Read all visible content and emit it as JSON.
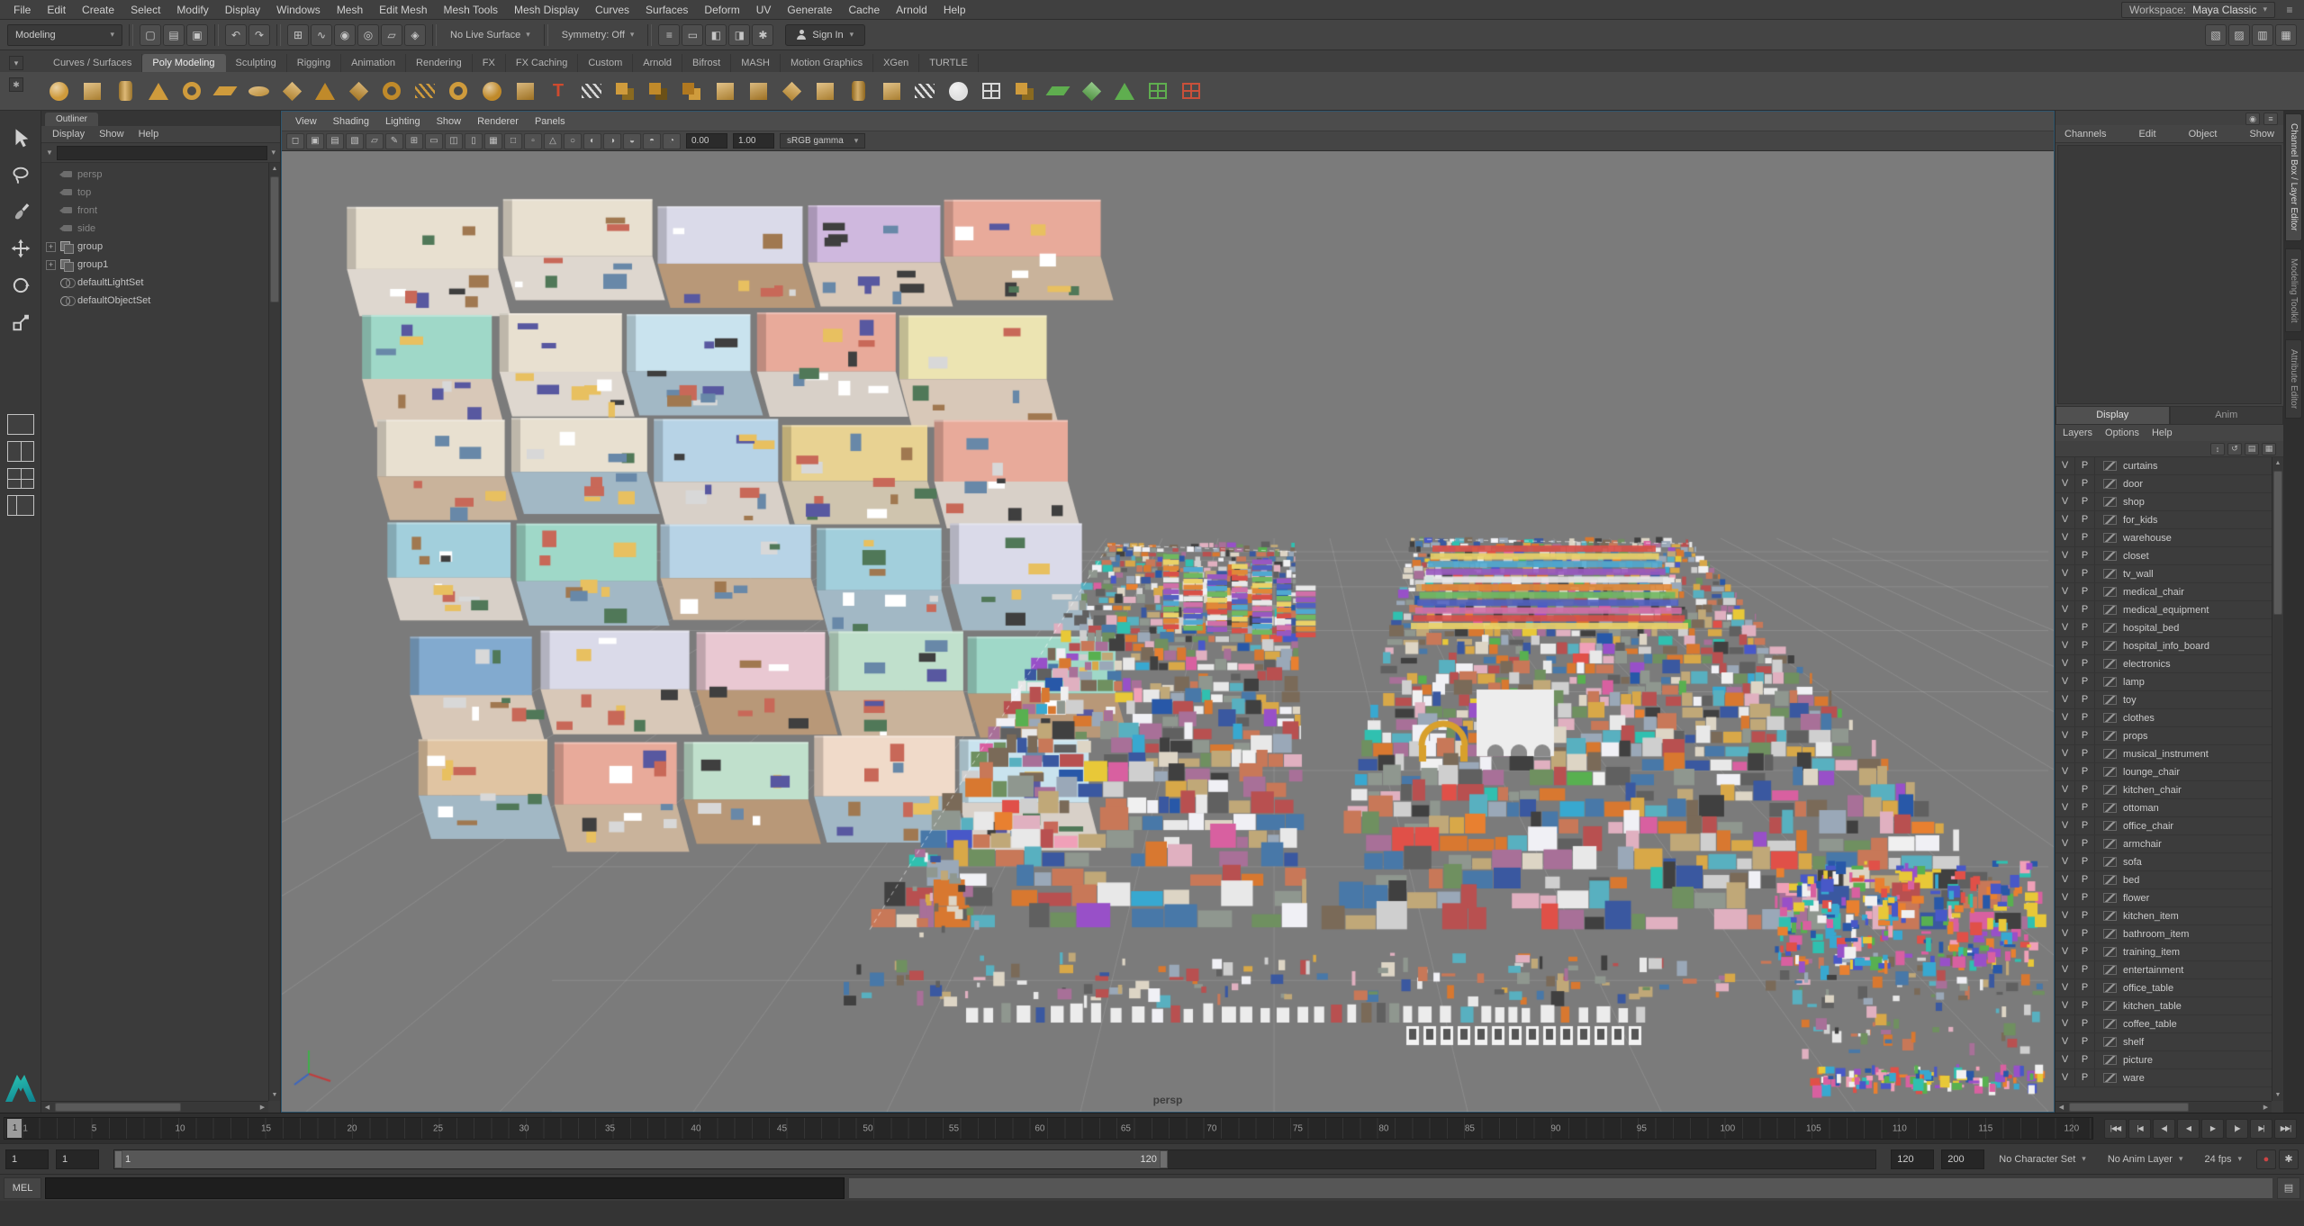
{
  "menubar": {
    "menus": [
      "File",
      "Edit",
      "Create",
      "Select",
      "Modify",
      "Display",
      "Windows",
      "Mesh",
      "Edit Mesh",
      "Mesh Tools",
      "Mesh Display",
      "Curves",
      "Surfaces",
      "Deform",
      "UV",
      "Generate",
      "Cache",
      "Arnold",
      "Help"
    ],
    "workspace_label": "Workspace:",
    "workspace_value": "Maya Classic"
  },
  "statusline": {
    "mode": "Modeling",
    "file_icons": [
      {
        "name": "new-scene-icon",
        "glyph": "▢"
      },
      {
        "name": "open-scene-icon",
        "glyph": "▤"
      },
      {
        "name": "save-scene-icon",
        "glyph": "▣"
      }
    ],
    "history_icons": [
      {
        "name": "undo-icon",
        "glyph": "↶"
      },
      {
        "name": "redo-icon",
        "glyph": "↷"
      }
    ],
    "snap_icons": [
      {
        "name": "snap-to-grid-icon",
        "glyph": "⊞"
      },
      {
        "name": "snap-to-curve-icon",
        "glyph": "∿"
      },
      {
        "name": "snap-to-point-icon",
        "glyph": "◉"
      },
      {
        "name": "snap-to-projected-center-icon",
        "glyph": "◎"
      },
      {
        "name": "snap-to-view-plane-icon",
        "glyph": "▱"
      },
      {
        "name": "make-live-icon",
        "glyph": "◈"
      }
    ],
    "no_live_surface": "No Live Surface",
    "symmetry": "Symmetry: Off",
    "render_icons": [
      {
        "name": "construction-history-icon",
        "glyph": "≡"
      },
      {
        "name": "open-render-view-icon",
        "glyph": "▭"
      },
      {
        "name": "render-current-frame-icon",
        "glyph": "◧"
      },
      {
        "name": "ipr-render-icon",
        "glyph": "◨"
      },
      {
        "name": "render-settings-icon",
        "glyph": "✱"
      }
    ],
    "sign_in": "Sign In",
    "right_icons": [
      {
        "name": "toggle-modeling-toolkit-icon",
        "glyph": "▧"
      },
      {
        "name": "toggle-tool-settings-icon",
        "glyph": "▨"
      },
      {
        "name": "toggle-attribute-editor-icon",
        "glyph": "▥"
      },
      {
        "name": "toggle-channel-box-icon",
        "glyph": "▦"
      }
    ]
  },
  "shelf": {
    "gutter_icons": [
      {
        "name": "shelf-tab-options-icon",
        "glyph": "▾"
      },
      {
        "name": "shelf-editor-icon",
        "glyph": "✱"
      }
    ],
    "tabs": [
      "Curves / Surfaces",
      "Poly Modeling",
      "Sculpting",
      "Rigging",
      "Animation",
      "Rendering",
      "FX",
      "FX Caching",
      "Custom",
      "Arnold",
      "Bifrost",
      "MASH",
      "Motion Graphics",
      "XGen",
      "TURTLE"
    ],
    "active_tab": "Poly Modeling",
    "icons": [
      {
        "name": "polygon-sphere-icon",
        "shape": "circle",
        "color": "#cf9b3c"
      },
      {
        "name": "polygon-cube-icon",
        "shape": "square",
        "color": "#cf9b3c"
      },
      {
        "name": "polygon-cylinder-icon",
        "shape": "rect",
        "color": "#cf9b3c"
      },
      {
        "name": "polygon-cone-icon",
        "shape": "tri",
        "color": "#cf9b3c"
      },
      {
        "name": "polygon-torus-icon",
        "shape": "ring",
        "color": "#cf9b3c"
      },
      {
        "name": "polygon-plane-icon",
        "shape": "flat",
        "color": "#cf9b3c"
      },
      {
        "name": "polygon-disc-icon",
        "shape": "ellipse",
        "color": "#cf9b3c"
      },
      {
        "name": "polygon-platonic-icon",
        "shape": "diamond",
        "color": "#cf9b3c"
      },
      {
        "name": "polygon-pyramid-icon",
        "shape": "tri",
        "color": "#c08a2a"
      },
      {
        "name": "polygon-prism-icon",
        "shape": "diamond",
        "color": "#c08a2a"
      },
      {
        "name": "polygon-pipe-icon",
        "shape": "ring",
        "color": "#c08a2a"
      },
      {
        "name": "polygon-helix-icon",
        "shape": "lines",
        "color": "#cf9b3c"
      },
      {
        "name": "polygon-gear-icon",
        "shape": "ring",
        "color": "#cf9b3c"
      },
      {
        "name": "polygon-soccer-ball-icon",
        "shape": "circle",
        "color": "#c08a2a"
      },
      {
        "name": "polygon-superellipse-icon",
        "shape": "square",
        "color": "#c08a2a"
      },
      {
        "name": "polygon-type-icon",
        "shape": "letter",
        "glyph": "T",
        "color": "#cf4a2e"
      },
      {
        "name": "sweep-mesh-icon",
        "shape": "lines",
        "color": "#d8d8d8"
      },
      {
        "name": "boolean-union-icon",
        "shape": "overlap",
        "color": "#cf9b3c",
        "color2": "#8a6a20"
      },
      {
        "name": "boolean-difference-icon",
        "shape": "overlap",
        "color": "#c08a2a",
        "color2": "#6a5018"
      },
      {
        "name": "boolean-intersection-icon",
        "shape": "overlap",
        "color": "#b07820",
        "color2": "#cf9b3c"
      },
      {
        "name": "combine-icon",
        "shape": "square",
        "color": "#cf9b3c"
      },
      {
        "name": "separate-icon",
        "shape": "square",
        "color": "#c08a2a"
      },
      {
        "name": "extract-icon",
        "shape": "diamond",
        "color": "#cf9b3c"
      },
      {
        "name": "bevel-icon",
        "shape": "square",
        "color": "#cf9b3c"
      },
      {
        "name": "bridge-icon",
        "shape": "rect",
        "color": "#c08a2a"
      },
      {
        "name": "extrude-icon",
        "shape": "square",
        "color": "#cf9b3c"
      },
      {
        "name": "multi-cut-icon",
        "shape": "lines",
        "color": "#e0e0e0"
      },
      {
        "name": "target-weld-icon",
        "shape": "circle",
        "color": "#e0e0e0"
      },
      {
        "name": "quad-draw-icon",
        "shape": "grid",
        "color": "#d8d8d8"
      },
      {
        "name": "mirror-icon",
        "shape": "overlap",
        "color": "#cf9b3c",
        "color2": "#8a6a20"
      },
      {
        "name": "uv-planar-projection-icon",
        "shape": "flat",
        "color": "#5fae4f"
      },
      {
        "name": "uv-automatic-projection-icon",
        "shape": "diamond",
        "color": "#5fae4f"
      },
      {
        "name": "uv-camera-projection-icon",
        "shape": "tri",
        "color": "#5fae4f"
      },
      {
        "name": "uv-editor-icon",
        "shape": "grid",
        "color": "#5fae4f"
      },
      {
        "name": "uv-snapshot-icon",
        "shape": "grid",
        "color": "#c9503a"
      }
    ]
  },
  "toolbox": {
    "tools": [
      {
        "name": "select-tool"
      },
      {
        "name": "lasso-tool"
      },
      {
        "name": "paint-select-tool"
      },
      {
        "name": "move-tool"
      },
      {
        "name": "rotate-tool"
      },
      {
        "name": "scale-tool"
      }
    ],
    "layouts": [
      {
        "name": "single-pane-layout"
      },
      {
        "name": "two-pane-layout"
      },
      {
        "name": "four-pane-layout"
      },
      {
        "name": "persp-outliner-layout"
      }
    ]
  },
  "outliner": {
    "title": "Outliner",
    "menus": [
      "Display",
      "Show",
      "Help"
    ],
    "items": [
      {
        "label": "persp",
        "type": "camera",
        "dim": true
      },
      {
        "label": "top",
        "type": "camera",
        "dim": true
      },
      {
        "label": "front",
        "type": "camera",
        "dim": true
      },
      {
        "label": "side",
        "type": "camera",
        "dim": true
      },
      {
        "label": "group",
        "type": "transform",
        "expander": true
      },
      {
        "label": "group1",
        "type": "transform",
        "expander": true
      },
      {
        "label": "defaultLightSet",
        "type": "set"
      },
      {
        "label": "defaultObjectSet",
        "type": "set"
      }
    ]
  },
  "viewport": {
    "menus": [
      "View",
      "Shading",
      "Lighting",
      "Show",
      "Renderer",
      "Panels"
    ],
    "toolbar_icons": [
      {
        "name": "camera-lock-icon",
        "glyph": "◻"
      },
      {
        "name": "camera-attributes-icon",
        "glyph": "▣"
      },
      {
        "name": "camera-bookmark-icon",
        "glyph": "▤"
      },
      {
        "name": "image-plane-icon",
        "glyph": "▧"
      },
      {
        "name": "two-d-pan-zoom-icon",
        "glyph": "▱"
      },
      {
        "name": "grease-pencil-icon",
        "glyph": "✎"
      },
      {
        "name": "grid-icon",
        "glyph": "⊞"
      },
      {
        "name": "film-gate-icon",
        "glyph": "▭"
      },
      {
        "name": "resolution-gate-icon",
        "glyph": "◫"
      },
      {
        "name": "gate-mask-icon",
        "glyph": "▯"
      },
      {
        "name": "field-chart-icon",
        "glyph": "▦"
      },
      {
        "name": "safe-action-icon",
        "glyph": "□"
      },
      {
        "name": "safe-title-icon",
        "glyph": "▫"
      },
      {
        "name": "isolate-select-icon",
        "glyph": "△"
      },
      {
        "name": "lighting-icon",
        "glyph": "○"
      },
      {
        "name": "shadows-icon",
        "glyph": "◐"
      },
      {
        "name": "screen-space-ao-icon",
        "glyph": "◑"
      },
      {
        "name": "motion-blur-icon",
        "glyph": "◒"
      },
      {
        "name": "multisample-aa-icon",
        "glyph": "◓"
      },
      {
        "name": "depth-of-field-icon",
        "glyph": "◔"
      }
    ],
    "exposure": "0.00",
    "gamma": "1.00",
    "color_space": "sRGB gamma",
    "camera_label": "persp"
  },
  "channelbox": {
    "top_icons": [
      {
        "name": "channel-box-pin-icon",
        "glyph": "◉"
      },
      {
        "name": "channel-box-options-icon",
        "glyph": "≡"
      }
    ],
    "menus": [
      "Channels",
      "Edit",
      "Object",
      "Show"
    ],
    "tabs": [
      {
        "label": "Display",
        "active": true
      },
      {
        "label": "Anim",
        "active": false
      }
    ],
    "layer_menus": [
      "Layers",
      "Options",
      "Help"
    ],
    "layer_toolbar_icons": [
      {
        "name": "layer-sort-icon",
        "glyph": "↕"
      },
      {
        "name": "layer-sync-icon",
        "glyph": "↺"
      },
      {
        "name": "add-empty-layer-icon",
        "glyph": "▤"
      },
      {
        "name": "add-layer-from-selection-icon",
        "glyph": "▦"
      }
    ],
    "visibility_col": "V",
    "playback_col": "P",
    "layers": [
      "curtains",
      "door",
      "shop",
      "for_kids",
      "warehouse",
      "closet",
      "tv_wall",
      "medical_chair",
      "medical_equipment",
      "hospital_bed",
      "hospital_info_board",
      "electronics",
      "lamp",
      "toy",
      "clothes",
      "props",
      "musical_instrument",
      "lounge_chair",
      "kitchen_chair",
      "ottoman",
      "office_chair",
      "armchair",
      "sofa",
      "bed",
      "flower",
      "kitchen_item",
      "bathroom_item",
      "training_item",
      "entertainment",
      "office_table",
      "kitchen_table",
      "coffee_table",
      "shelf",
      "picture",
      "ware"
    ]
  },
  "side_tabs": [
    {
      "label": "Channel Box / Layer Editor",
      "active": true
    },
    {
      "label": "Modeling Toolkit",
      "active": false
    },
    {
      "label": "Attribute Editor",
      "active": false
    }
  ],
  "timeline": {
    "start": 1,
    "end": 120,
    "label_step": 5,
    "current": 1,
    "playback": [
      {
        "name": "go-to-start-button",
        "glyph": "|◀◀"
      },
      {
        "name": "step-back-frame-button",
        "glyph": "|◀"
      },
      {
        "name": "step-back-key-button",
        "glyph": "◀|"
      },
      {
        "name": "play-backwards-button",
        "glyph": "◀"
      },
      {
        "name": "play-forwards-button",
        "glyph": "▶"
      },
      {
        "name": "step-forward-key-button",
        "glyph": "|▶"
      },
      {
        "name": "step-forward-frame-button",
        "glyph": "▶|"
      },
      {
        "name": "go-to-end-button",
        "glyph": "▶▶|"
      }
    ]
  },
  "rangeslider": {
    "anim_start": "1",
    "playback_start": "1",
    "playback_end": "120",
    "anim_end": "200",
    "bar_start": "1",
    "bar_end": "120",
    "character_set": "No Character Set",
    "anim_layer": "No Anim Layer",
    "fps": "24 fps",
    "icons": [
      {
        "name": "auto-keyframe-icon",
        "glyph": "●"
      },
      {
        "name": "animation-preferences-icon",
        "glyph": "✱"
      }
    ]
  },
  "commandline": {
    "label": "MEL"
  }
}
